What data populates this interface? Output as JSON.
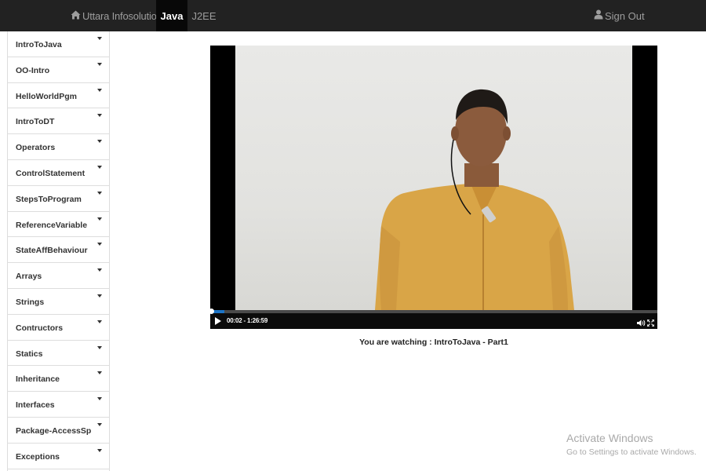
{
  "navbar": {
    "brand": "Uttara Infosolutions",
    "brand_icon": "home-icon",
    "tabs": [
      {
        "label": "Java",
        "active": true
      },
      {
        "label": "J2EE",
        "active": false
      }
    ],
    "signout": "Sign Out",
    "signout_icon": "user-icon",
    "colors": {
      "background": "#222222",
      "active_tab": "#080808",
      "text": "#9d9d9d"
    }
  },
  "sidebar": {
    "items": [
      {
        "label": "IntroToJava"
      },
      {
        "label": "OO-Intro"
      },
      {
        "label": "HelloWorldPgm"
      },
      {
        "label": "IntroToDT"
      },
      {
        "label": "Operators"
      },
      {
        "label": "ControlStatement"
      },
      {
        "label": "StepsToProgram"
      },
      {
        "label": "ReferenceVariable"
      },
      {
        "label": "StateAffBehaviour"
      },
      {
        "label": "Arrays"
      },
      {
        "label": "Strings"
      },
      {
        "label": "Contructors"
      },
      {
        "label": "Statics"
      },
      {
        "label": "Inheritance"
      },
      {
        "label": "Interfaces"
      },
      {
        "label": "Package-AccessSp"
      },
      {
        "label": "Exceptions"
      }
    ],
    "item_icon": "caret-down-icon"
  },
  "video": {
    "time": "00:02 - 1:26:59",
    "progress": 0.0004,
    "progress_color": "#1d75c7"
  },
  "caption": "You are watching : IntroToJava - Part1",
  "watermark": {
    "title": "Activate Windows",
    "subtitle": "Go to Settings to activate Windows."
  }
}
